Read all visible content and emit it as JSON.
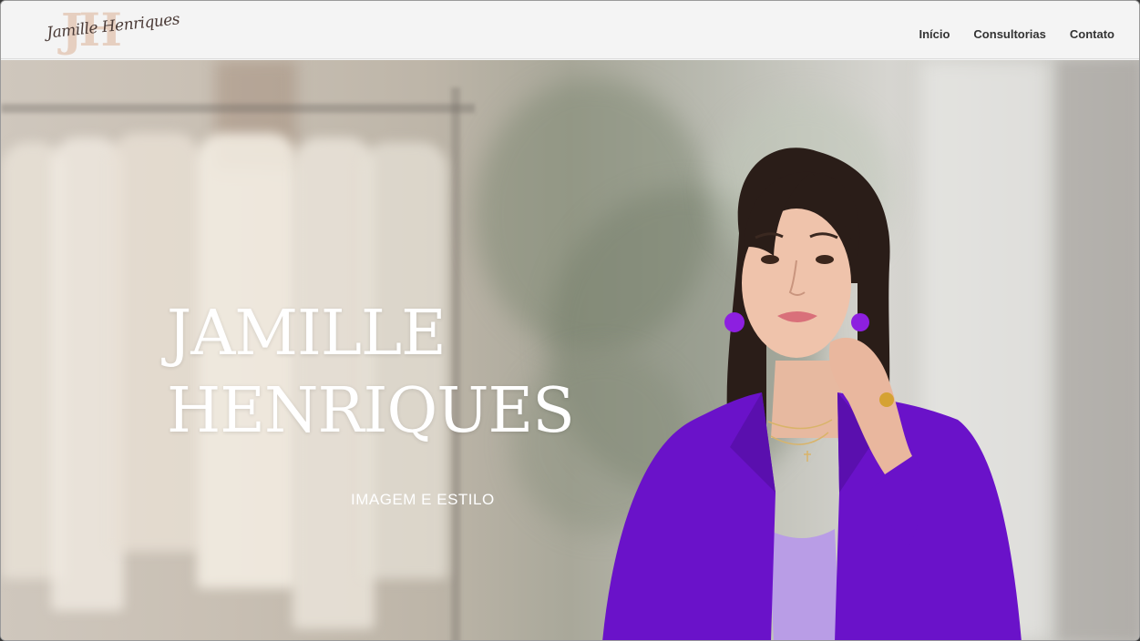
{
  "header": {
    "logo_script": "Jamille Henriques",
    "logo_mono": "JH",
    "nav": [
      {
        "label": "Início"
      },
      {
        "label": "Consultorias"
      },
      {
        "label": "Contato"
      }
    ]
  },
  "hero": {
    "title_line1": "JAMILLE",
    "title_line2": "HENRIQUES",
    "subtitle": "IMAGEM E ESTILO"
  },
  "colors": {
    "header_bg": "#f4f4f4",
    "nav_text": "#333333",
    "logo_mono": "#e6cfc0",
    "blazer": "#6a12c9",
    "hero_text": "#ffffff"
  }
}
